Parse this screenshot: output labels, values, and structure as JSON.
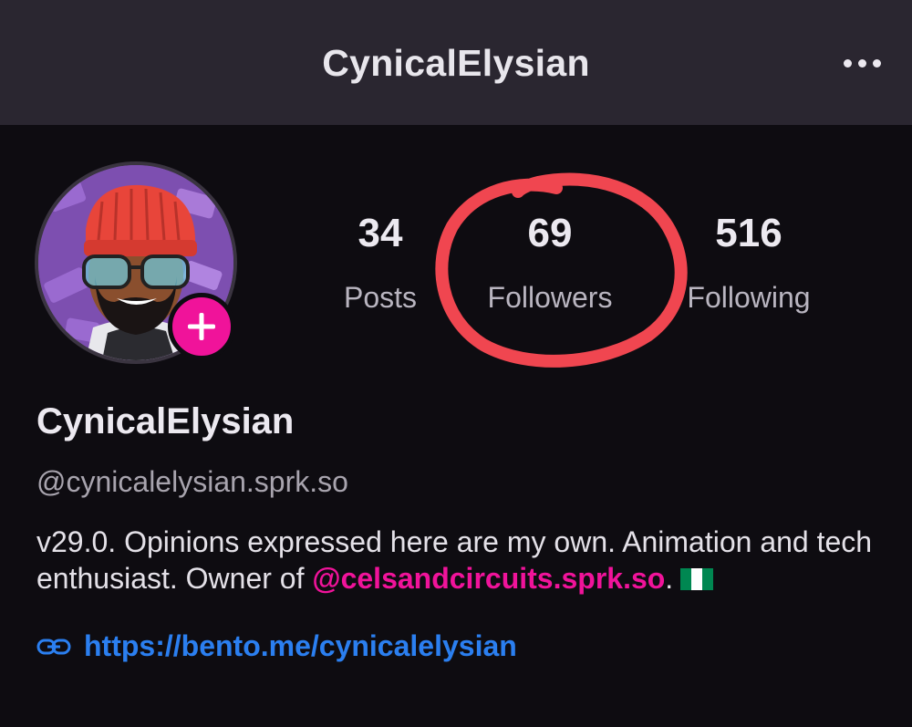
{
  "header": {
    "title": "CynicalElysian",
    "menu_icon": "more-horizontal-icon"
  },
  "profile": {
    "avatar_icon": "avatar-illustration",
    "add_icon": "plus-icon",
    "display_name": "CynicalElysian",
    "handle": "@cynicalelysian.sprk.so",
    "bio_text": "v29.0. Opinions expressed here are my own. Animation and tech enthusiast. Owner of ",
    "bio_mention": "@celsandcircuits.sprk.so",
    "bio_suffix": ".",
    "flag_icon": "nigeria-flag-icon",
    "link_icon": "link-icon",
    "link": "https://bento.me/cynicalelysian"
  },
  "stats": {
    "posts": {
      "value": "34",
      "label": "Posts"
    },
    "followers": {
      "value": "69",
      "label": "Followers"
    },
    "following": {
      "value": "516",
      "label": "Following"
    }
  },
  "colors": {
    "accent": "#f0139a",
    "link": "#2b7ff0",
    "annotation": "#f04650",
    "background": "#0e0c11",
    "header": "#2a2630"
  }
}
